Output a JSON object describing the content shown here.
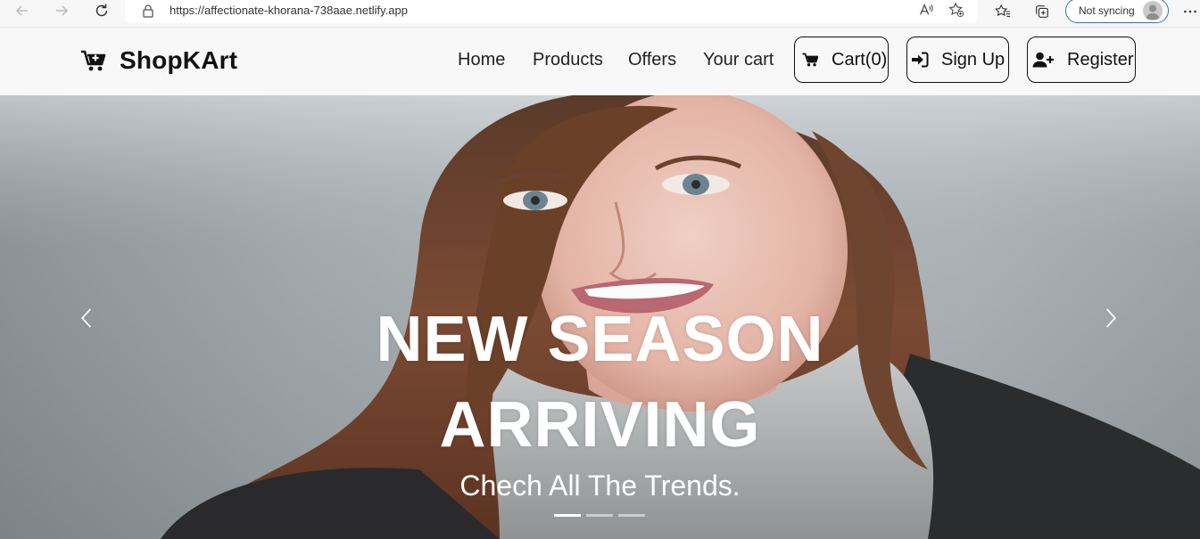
{
  "browser": {
    "url": "https://affectionate-khorana-738aae.netlify.app",
    "profile_label": "Not syncing",
    "icons": [
      "back-icon",
      "forward-icon",
      "refresh-icon",
      "lock-icon",
      "read-aloud-icon",
      "add-favorite-icon",
      "favorites-icon",
      "collections-icon",
      "avatar",
      "more-icon"
    ]
  },
  "navbar": {
    "brand": "ShopKArt",
    "brand_icon": "cart-plus-icon",
    "links": {
      "home": "Home",
      "products": "Products",
      "offers": "Offers",
      "your_cart": "Your cart"
    },
    "buttons": {
      "cart": "Cart(0)",
      "signup": "Sign Up",
      "register": "Register"
    },
    "button_icons": [
      "cart-icon",
      "sign-in-icon",
      "user-plus-icon"
    ],
    "background": "#f8f8f8"
  },
  "hero": {
    "title_line1": "NEW SEASON",
    "title_line2": "ARRIVING",
    "subtitle": "Chech All The Trends.",
    "slides": 3,
    "active_slide": 1,
    "text_color": "#ffffff"
  }
}
